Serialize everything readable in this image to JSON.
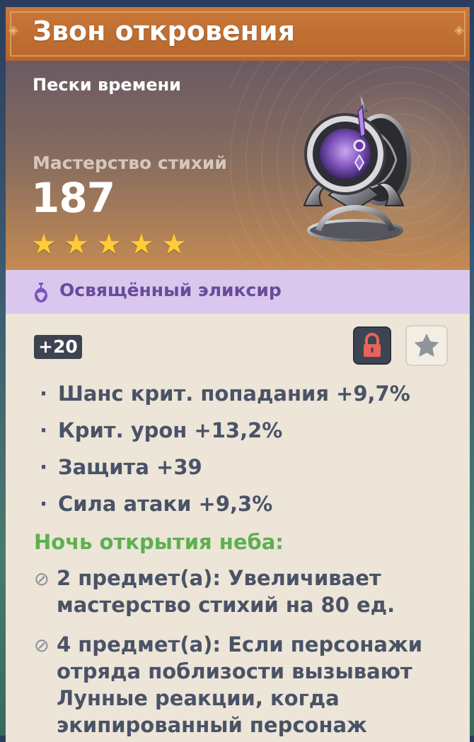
{
  "artifact": {
    "name": "Звон откровения",
    "slot": "Пески времени",
    "main_stat": {
      "name": "Мастерство стихий",
      "value": "187"
    },
    "rarity_stars": 5,
    "elixir_label": "Освящённый эликсир",
    "level": "+20",
    "locked": true,
    "favorite": false,
    "substats": [
      "Шанс крит. попадания +9,7%",
      "Крит. урон +13,2%",
      "Защита +39",
      "Сила атаки +9,3%"
    ],
    "set": {
      "name": "Ночь открытия неба:",
      "bonus2": [
        "2 предмет(а): Увеличивает",
        "мастерство стихий на 80 ед."
      ],
      "bonus4": [
        "4 предмет(а): Если персонажи",
        "отряда поблизости вызывают",
        "Лунные реакции, когда",
        "экипированный персонаж"
      ]
    }
  },
  "colors": {
    "title_bg": "#b8662c",
    "elixir_bg": "#d9c7ee",
    "elixir_text": "#6a4a9a",
    "set_name": "#5db04f",
    "body_text": "#4a5366",
    "star": "#ffcc33",
    "lock_bg": "#3d4553",
    "lock_icon": "#e8645a"
  },
  "icons": {
    "elixir": "potion-icon",
    "lock": "padlock-icon",
    "favorite": "star-icon",
    "set_bonus_inactive": "inactive-circle-slash-icon"
  }
}
